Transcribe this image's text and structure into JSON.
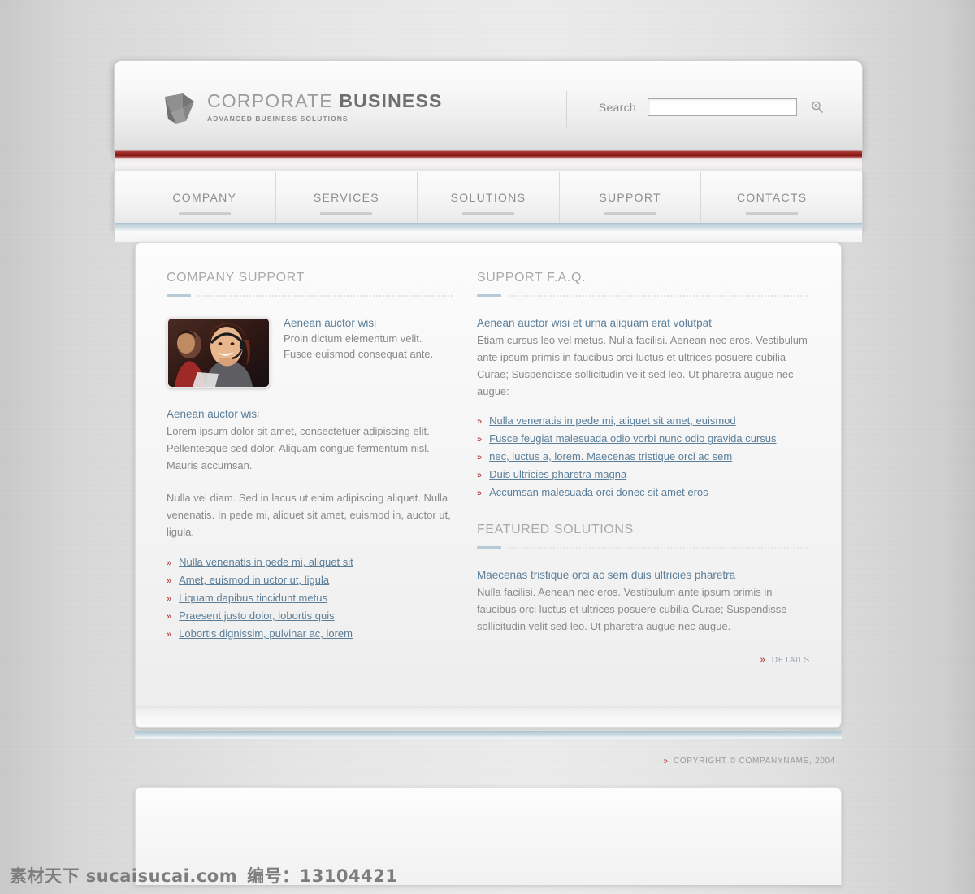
{
  "brand": {
    "logo_icon": "cube-arrow-logo-icon",
    "title_light": "CORPORATE ",
    "title_bold": "BUSINESS",
    "tagline": "ADVANCED BUSINESS SOLUTIONS"
  },
  "search": {
    "label": "Search",
    "value": "",
    "placeholder": "",
    "icon": "magnifier-icon"
  },
  "nav": {
    "items": [
      {
        "label": "COMPANY"
      },
      {
        "label": "SERVICES"
      },
      {
        "label": "SOLUTIONS"
      },
      {
        "label": "SUPPORT"
      },
      {
        "label": "CONTACTS"
      }
    ]
  },
  "left": {
    "heading": "COMPANY SUPPORT",
    "media": {
      "image_alt": "call-center-agent-photo",
      "title": "Aenean auctor wisi",
      "text": "Proin dictum elementum velit. Fusce euismod consequat ante."
    },
    "article_title": "Aenean auctor wisi",
    "paragraph1": "Lorem ipsum dolor sit amet, consectetuer adipiscing elit. Pellentesque sed dolor. Aliquam congue fermentum nisl. Mauris accumsan.",
    "paragraph2": "Nulla vel diam. Sed in lacus ut enim adipiscing aliquet. Nulla venenatis. In pede mi, aliquet sit amet, euismod in, auctor ut, ligula.",
    "links": [
      "Nulla venenatis in pede mi, aliquet sit",
      "Amet, euismod in uctor ut, ligula",
      "Liquam dapibus tincidunt metus",
      "Praesent justo dolor, lobortis quis",
      "Lobortis dignissim, pulvinar ac, lorem"
    ]
  },
  "right": {
    "faq": {
      "heading": "SUPPORT F.A.Q.",
      "title": "Aenean auctor wisi et urna aliquam erat volutpat",
      "text": "Etiam cursus leo vel metus. Nulla facilisi. Aenean nec eros. Vestibulum ante ipsum primis in faucibus orci luctus et ultrices posuere cubilia Curae; Suspendisse sollicitudin velit sed leo. Ut pharetra augue nec augue:",
      "links": [
        "Nulla venenatis in pede mi, aliquet sit amet, euismod",
        "Fusce feugiat malesuada odio vorbi nunc odio gravida cursus",
        "nec, luctus a, lorem. Maecenas tristique orci ac sem",
        "Duis ultricies pharetra magna",
        "Accumsan malesuada orci donec sit amet eros"
      ]
    },
    "featured": {
      "heading": "FEATURED SOLUTIONS",
      "title": "Maecenas tristique orci ac sem duis ultricies pharetra",
      "text": "Nulla facilisi. Aenean nec eros. Vestibulum ante ipsum primis in faucibus orci luctus et ultrices posuere cubilia Curae; Suspendisse sollicitudin velit sed leo. Ut pharetra augue nec augue.",
      "details_label": "DETAILS"
    }
  },
  "footer": {
    "copyright": "COPYRIGHT © COMPANYNAME, 2004"
  },
  "watermark": {
    "site": "素材天下 sucaisucai.com",
    "code": "编号：13104421"
  },
  "colors": {
    "accent_red": "#9d1f1c",
    "link_blue": "#5b7f9a",
    "rule_blue": "#b7cbd6",
    "bullet_red": "#a61f1f",
    "heading_gray": "#a9a9a9",
    "body_gray": "#8a8a8a"
  }
}
